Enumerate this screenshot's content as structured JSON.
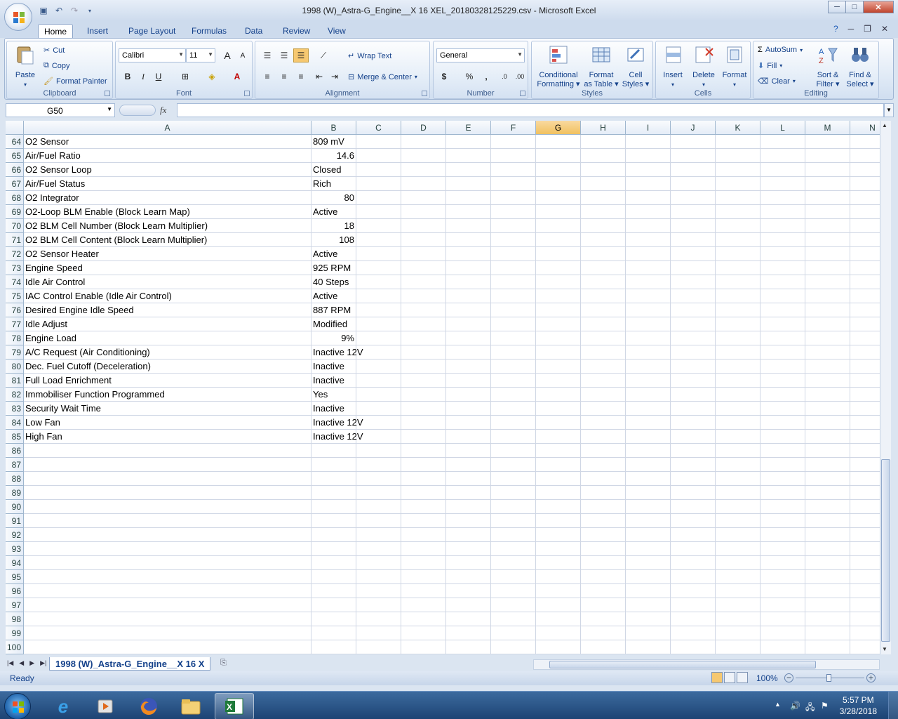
{
  "window": {
    "title": "1998 (W)_Astra-G_Engine__X 16 XEL_20180328125229.csv - Microsoft Excel",
    "minimize": "─",
    "maximize": "□",
    "close": "✕"
  },
  "ribbon_tabs": [
    "Home",
    "Insert",
    "Page Layout",
    "Formulas",
    "Data",
    "Review",
    "View"
  ],
  "clipboard": {
    "paste": "Paste",
    "cut": "Cut",
    "copy": "Copy",
    "format_painter": "Format Painter",
    "label": "Clipboard"
  },
  "font": {
    "name": "Calibri",
    "size": "11",
    "label": "Font",
    "bold": "B",
    "italic": "I",
    "underline": "U",
    "grow": "A",
    "shrink": "A"
  },
  "alignment": {
    "wrap_text": "Wrap Text",
    "merge_center": "Merge & Center",
    "label": "Alignment"
  },
  "number": {
    "format": "General",
    "currency": "$",
    "percent": "%",
    "comma": ",",
    "inc_decimal": ".0",
    "dec_decimal": ".00",
    "label": "Number"
  },
  "styles": {
    "conditional": "Conditional",
    "conditional2": "Formatting",
    "format_table": "Format",
    "format_table2": "as Table",
    "cell_styles": "Cell",
    "cell_styles2": "Styles",
    "label": "Styles"
  },
  "cells": {
    "insert": "Insert",
    "delete": "Delete",
    "format": "Format",
    "label": "Cells"
  },
  "editing": {
    "autosum": "AutoSum",
    "fill": "Fill",
    "clear": "Clear",
    "sort": "Sort &",
    "sort2": "Filter",
    "find": "Find &",
    "find2": "Select",
    "label": "Editing"
  },
  "formula_bar": {
    "name_box": "G50",
    "fx": "fx",
    "value": ""
  },
  "columns": [
    "A",
    "B",
    "C",
    "D",
    "E",
    "F",
    "G",
    "H",
    "I",
    "J",
    "K",
    "L",
    "M",
    "N"
  ],
  "selected_column": "G",
  "rows": [
    {
      "n": "64",
      "a": "O2 Sensor",
      "b": "809 mV",
      "num": false
    },
    {
      "n": "65",
      "a": "Air/Fuel Ratio",
      "b": "14.6",
      "num": true
    },
    {
      "n": "66",
      "a": "O2 Sensor Loop",
      "b": "Closed",
      "num": false
    },
    {
      "n": "67",
      "a": "Air/Fuel Status",
      "b": "Rich",
      "num": false
    },
    {
      "n": "68",
      "a": "O2 Integrator",
      "b": "80",
      "num": true
    },
    {
      "n": "69",
      "a": "O2-Loop BLM Enable (Block Learn Map)",
      "b": "Active",
      "num": false
    },
    {
      "n": "70",
      "a": "O2 BLM Cell Number (Block Learn Multiplier)",
      "b": "18",
      "num": true
    },
    {
      "n": "71",
      "a": "O2 BLM Cell Content (Block Learn Multiplier)",
      "b": "108",
      "num": true
    },
    {
      "n": "72",
      "a": "O2 Sensor Heater",
      "b": "Active",
      "num": false
    },
    {
      "n": "73",
      "a": "Engine Speed",
      "b": "925 RPM",
      "num": false
    },
    {
      "n": "74",
      "a": "Idle Air Control",
      "b": "40 Steps",
      "num": false
    },
    {
      "n": "75",
      "a": "IAC Control Enable (Idle Air Control)",
      "b": "Active",
      "num": false
    },
    {
      "n": "76",
      "a": "Desired Engine Idle Speed",
      "b": "887 RPM",
      "num": false
    },
    {
      "n": "77",
      "a": "Idle Adjust",
      "b": "Modified",
      "num": false
    },
    {
      "n": "78",
      "a": "Engine Load",
      "b": "9%",
      "num": true
    },
    {
      "n": "79",
      "a": "A/C Request (Air Conditioning)",
      "b": "Inactive 12V",
      "num": false
    },
    {
      "n": "80",
      "a": "Dec. Fuel Cutoff (Deceleration)",
      "b": "Inactive",
      "num": false
    },
    {
      "n": "81",
      "a": "Full Load Enrichment",
      "b": "Inactive",
      "num": false
    },
    {
      "n": "82",
      "a": "Immobiliser Function Programmed",
      "b": "Yes",
      "num": false
    },
    {
      "n": "83",
      "a": "Security Wait Time",
      "b": "Inactive",
      "num": false
    },
    {
      "n": "84",
      "a": "Low Fan",
      "b": "Inactive 12V",
      "num": false
    },
    {
      "n": "85",
      "a": "High Fan",
      "b": "Inactive 12V",
      "num": false
    },
    {
      "n": "86",
      "a": "",
      "b": "",
      "num": false
    },
    {
      "n": "87",
      "a": "",
      "b": "",
      "num": false
    },
    {
      "n": "88",
      "a": "",
      "b": "",
      "num": false
    },
    {
      "n": "89",
      "a": "",
      "b": "",
      "num": false
    },
    {
      "n": "90",
      "a": "",
      "b": "",
      "num": false
    },
    {
      "n": "91",
      "a": "",
      "b": "",
      "num": false
    },
    {
      "n": "92",
      "a": "",
      "b": "",
      "num": false
    },
    {
      "n": "93",
      "a": "",
      "b": "",
      "num": false
    },
    {
      "n": "94",
      "a": "",
      "b": "",
      "num": false
    },
    {
      "n": "95",
      "a": "",
      "b": "",
      "num": false
    },
    {
      "n": "96",
      "a": "",
      "b": "",
      "num": false
    },
    {
      "n": "97",
      "a": "",
      "b": "",
      "num": false
    },
    {
      "n": "98",
      "a": "",
      "b": "",
      "num": false
    },
    {
      "n": "99",
      "a": "",
      "b": "",
      "num": false
    },
    {
      "n": "100",
      "a": "",
      "b": "",
      "num": false
    }
  ],
  "sheet_tab": "1998 (W)_Astra-G_Engine__X 16 X",
  "status": {
    "text": "Ready",
    "zoom": "100%"
  },
  "taskbar": {
    "time": "5:57 PM",
    "date": "3/28/2018"
  },
  "colors": {
    "accent": "#15428b",
    "selected_header": "#f1c15f",
    "gridline": "#d0d7e5"
  }
}
